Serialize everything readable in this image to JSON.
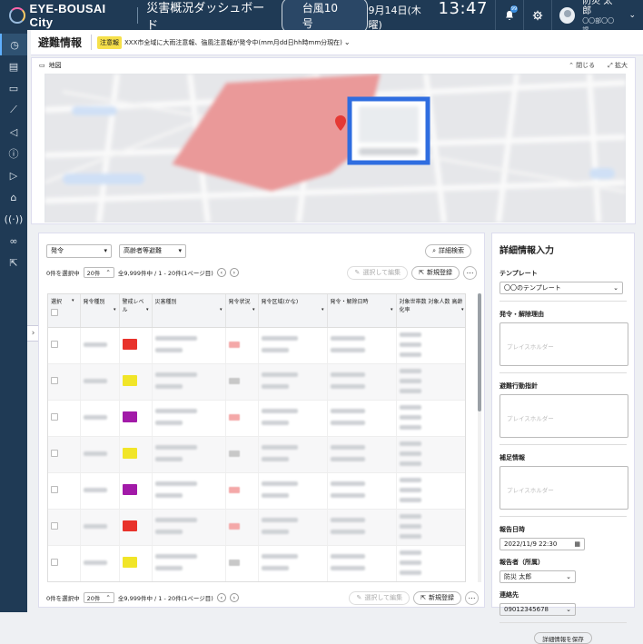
{
  "topbar": {
    "logo_text": "EYE-BOUSAI City",
    "app_title": "災害概況ダッシュボード",
    "typhoon_label": "台風10号",
    "date": "9月14日(木曜)",
    "time": "13:47",
    "notification_badge": "99",
    "user_name": "防災 太郎",
    "user_org": "〇〇部〇〇課"
  },
  "sidebar": {
    "icons": [
      "dashboard-icon",
      "report-icon",
      "map-icon",
      "chart-icon",
      "megaphone-icon",
      "info-icon",
      "video-icon",
      "house-icon",
      "broadcast-icon",
      "link-icon",
      "external-link-icon"
    ],
    "toggle": "›"
  },
  "page": {
    "title": "避難情報",
    "alert_chip": "注意報",
    "alert_text": "XXX市全域に大雨注意報、強風注意報が発令中(mm月dd日hh時mm分現在)"
  },
  "map": {
    "label": "地図",
    "close_label": "閉じる",
    "expand_label": "拡大"
  },
  "filters": {
    "issuance": "発令",
    "category": "高齢者等避難",
    "search_button": "詳細検索"
  },
  "pagination": {
    "selected_count": "0件を選択中",
    "page_size": "20件",
    "summary": "全9,999件中 / 1 - 20件(1ページ目)"
  },
  "actions": {
    "select_edit": "選択して編集",
    "new_register": "新規登録"
  },
  "table": {
    "columns": [
      "選択",
      "発令種別",
      "警戒レベル",
      "災害種別",
      "発令状況",
      "発令区域(かな)",
      "発令・解除日時",
      "対象世帯数 対象人数 高齢化率"
    ],
    "rows": [
      {
        "level_color": "#e8322b",
        "status_color": "#f4a8a8"
      },
      {
        "level_color": "#f1e528",
        "status_color": "#c8c8c8"
      },
      {
        "level_color": "#a21aa8",
        "status_color": "#f4a8a8"
      },
      {
        "level_color": "#f1e528",
        "status_color": "#c8c8c8"
      },
      {
        "level_color": "#a21aa8",
        "status_color": "#f4a8a8"
      },
      {
        "level_color": "#e8322b",
        "status_color": "#f4a8a8"
      },
      {
        "level_color": "#f1e528",
        "status_color": "#c8c8c8"
      },
      {
        "level_color": "#a21aa8",
        "status_color": "#f4a8a8"
      }
    ]
  },
  "detail": {
    "title": "詳細情報入力",
    "template_label": "テンプレート",
    "template_value": "〇〇のテンプレート",
    "reason_label": "発令・解除理由",
    "reason_placeholder": "プレイスホルダー",
    "guidance_label": "避難行動指針",
    "guidance_placeholder": "プレイスホルダー",
    "supplement_label": "補足情報",
    "supplement_placeholder": "プレイスホルダー",
    "report_date_label": "報告日時",
    "report_date_value": "2022/11/9 22:30",
    "reporter_label": "報告者（所属）",
    "reporter_value": "防災 太郎",
    "contact_label": "連絡先",
    "contact_value": "09012345678",
    "save_button": "詳細情報を保存"
  },
  "colors": {
    "header": "#1f3a55",
    "accent": "#3a8ddf",
    "alert": "#f6e04a",
    "map_highlight": "#2f6de0"
  }
}
